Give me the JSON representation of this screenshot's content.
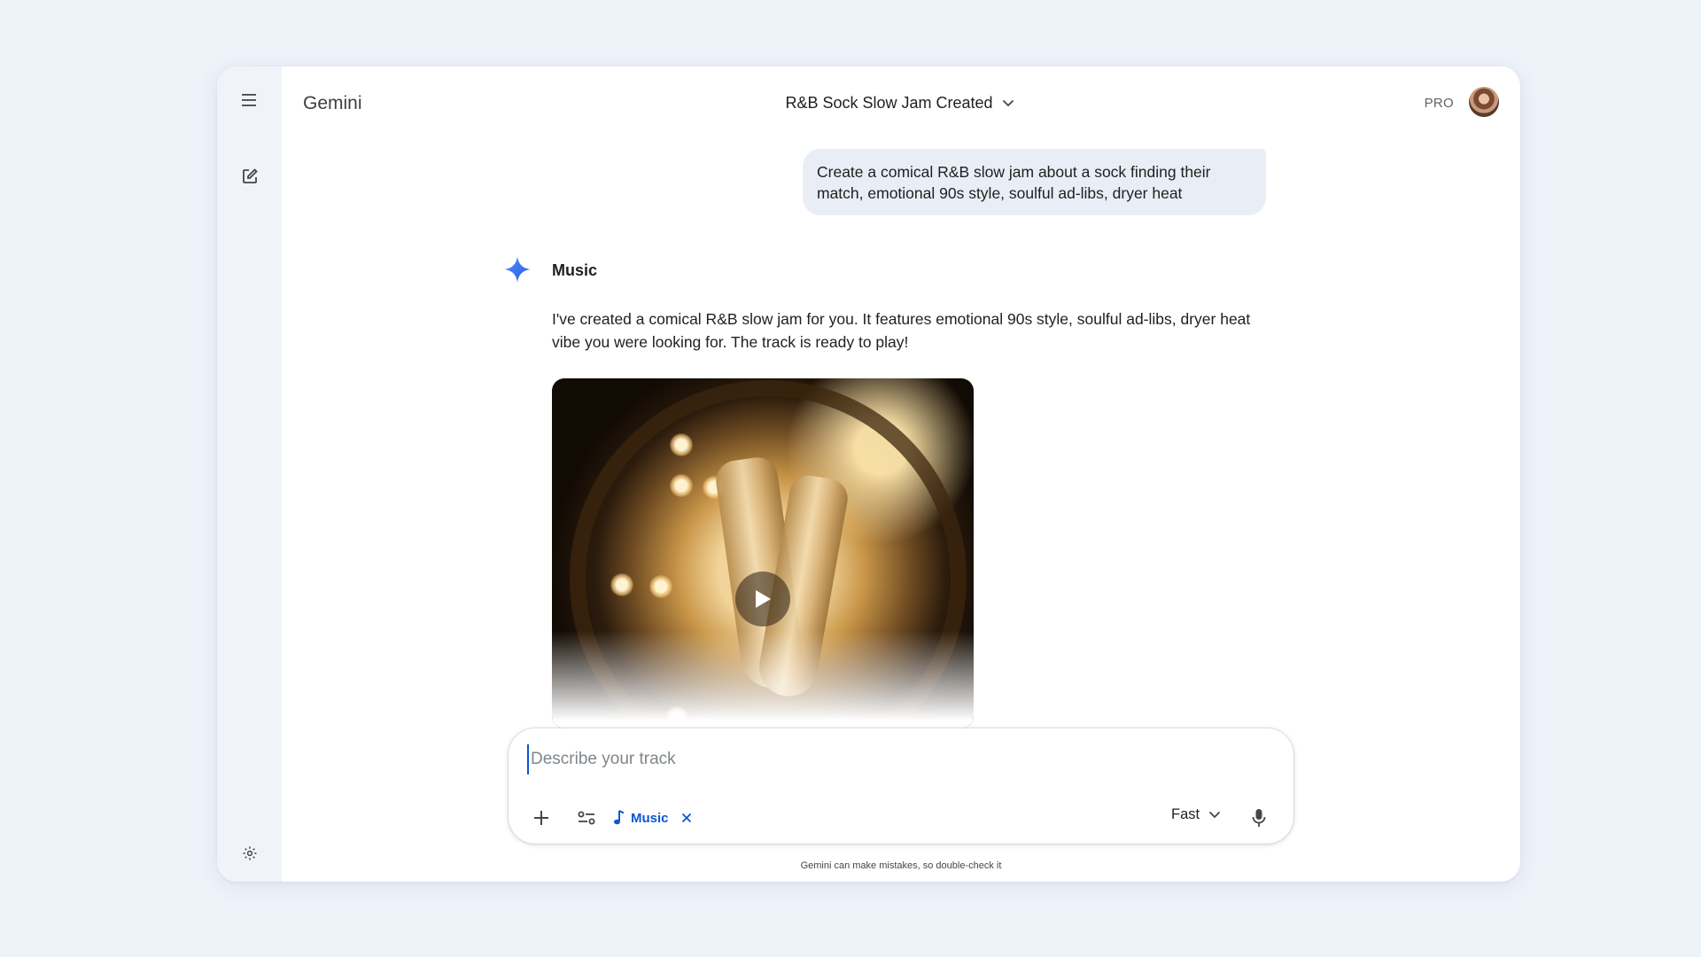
{
  "app": {
    "name": "Gemini",
    "tier": "PRO"
  },
  "conversation": {
    "title": "R&B Sock Slow Jam Created"
  },
  "user_message": "Create a comical R&B slow jam about a sock finding their match, emotional 90s style, soulful ad-libs, dryer heat",
  "response": {
    "label": "Music",
    "text": "I've created a comical R&B slow jam for you. It features emotional 90s style, soulful ad-libs, dryer heat vibe you were looking for. The track is ready to play!"
  },
  "composer": {
    "placeholder": "Describe your track",
    "tool_chip": "Music",
    "model": "Fast"
  },
  "disclaimer": "Gemini can make mistakes, so double-check it",
  "colors": {
    "accent": "#0b57d0",
    "rail": "#f0f4f9",
    "user_bubble": "#e9eef6"
  }
}
